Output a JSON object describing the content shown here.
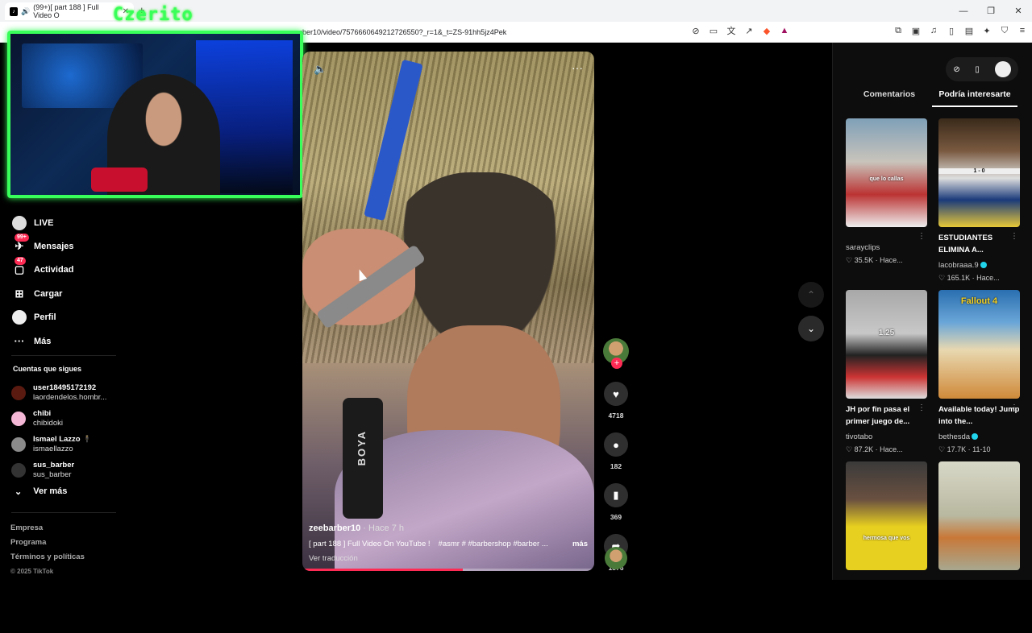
{
  "browser": {
    "tab_title": "(99+)[ part 188 ] Full Video O",
    "tab_icon": "tiktok-icon",
    "url": "rber10/video/7576660649212726550?_r=1&_t=ZS-91hh5jz4Pek"
  },
  "overlay": {
    "streamer_name": "Czerito",
    "frame_color": "#39ff5a"
  },
  "sidebar": {
    "nav": [
      {
        "label": "LIVE",
        "icon": "live-icon",
        "badge": ""
      },
      {
        "label": "Mensajes",
        "icon": "messages-icon",
        "badge": "99+"
      },
      {
        "label": "Actividad",
        "icon": "activity-icon",
        "badge": "47"
      },
      {
        "label": "Cargar",
        "icon": "upload-icon",
        "badge": ""
      },
      {
        "label": "Perfil",
        "icon": "profile-icon",
        "badge": ""
      },
      {
        "label": "Más",
        "icon": "more-icon",
        "badge": ""
      }
    ],
    "following_title": "Cuentas que sigues",
    "following": [
      {
        "name": "user18495172192",
        "handle": "laordendelos.hombr..."
      },
      {
        "name": "chibi",
        "handle": "chibidoki"
      },
      {
        "name": "Ismael Lazzo",
        "handle": "ismaellazzo"
      },
      {
        "name": "sus_barber",
        "handle": "sus_barber"
      }
    ],
    "see_more": "Ver más",
    "footer": [
      "Empresa",
      "Programa",
      "Términos y políticas"
    ],
    "copyright": "© 2025 TikTok"
  },
  "video": {
    "author": "zeebarber10",
    "time": "· Hace 7 h",
    "title": "[ part 188 ] Full Video On YouTube !",
    "tags": "#asmr # #barbershop #barber ...",
    "more": "más",
    "translate": "Ver traducción",
    "mic_label": "BOYA",
    "progress_fraction": 0.55,
    "accent": "#fe2c55"
  },
  "actions": {
    "likes": "4718",
    "comments": "182",
    "saves": "369",
    "shares": "1876"
  },
  "right_panel": {
    "tabs": [
      "Comentarios",
      "Podría interesarte"
    ],
    "active_tab": 1,
    "cards": [
      {
        "title": "",
        "user": "sarayclips",
        "verified": false,
        "likes": "35.5K",
        "time": "Hace...",
        "caption": "que lo callas"
      },
      {
        "title": "ESTUDIANTES ELIMINA A...",
        "user": "lacobraaa.9",
        "verified": true,
        "likes": "165.1K",
        "time": "Hace...",
        "caption": "1 - 0"
      },
      {
        "title": "JH por fin pasa el primer juego de...",
        "user": "tivotabo",
        "verified": false,
        "likes": "87.2K",
        "time": "Hace...",
        "caption": "1.25"
      },
      {
        "title": "Available today! Jump into the...",
        "user": "bethesda",
        "verified": true,
        "likes": "17.7K",
        "time": "11-10",
        "caption": "Fallout 4"
      },
      {
        "title": "",
        "user": "",
        "verified": false,
        "likes": "",
        "time": "",
        "caption": "hermosa que vos"
      },
      {
        "title": "",
        "user": "",
        "verified": false,
        "likes": "",
        "time": "",
        "caption": ""
      }
    ]
  }
}
